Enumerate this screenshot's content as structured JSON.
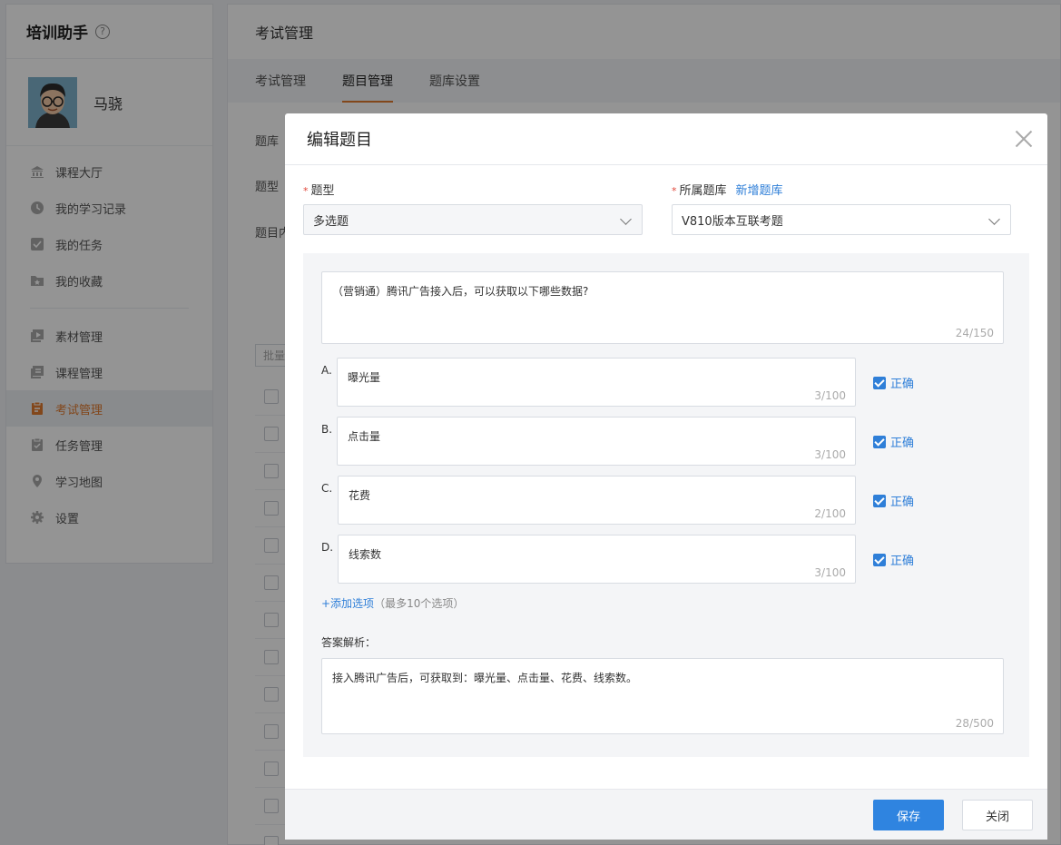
{
  "app": {
    "title": "培训助手",
    "help_icon": "?",
    "user_name": "马骁"
  },
  "sidebar": {
    "items": [
      {
        "label": "课程大厅",
        "icon": "bank-icon"
      },
      {
        "label": "我的学习记录",
        "icon": "clock-icon"
      },
      {
        "label": "我的任务",
        "icon": "checkbox-icon"
      },
      {
        "label": "我的收藏",
        "icon": "star-folder-icon"
      },
      {
        "label": "素材管理",
        "icon": "media-icon"
      },
      {
        "label": "课程管理",
        "icon": "course-icon"
      },
      {
        "label": "考试管理",
        "icon": "exam-icon",
        "active": true
      },
      {
        "label": "任务管理",
        "icon": "task-icon"
      },
      {
        "label": "学习地图",
        "icon": "map-pin-icon"
      },
      {
        "label": "设置",
        "icon": "gear-icon"
      }
    ]
  },
  "main": {
    "header": "考试管理",
    "tabs": [
      {
        "label": "考试管理"
      },
      {
        "label": "题目管理",
        "active": true
      },
      {
        "label": "题库设置"
      }
    ],
    "labels": {
      "bank": "题库",
      "type": "题型",
      "content": "题目内",
      "batch": "批量"
    }
  },
  "modal": {
    "title": "编辑题目",
    "type_label": "题型",
    "type_value": "多选题",
    "bank_label": "所属题库",
    "add_bank_link": "新增题库",
    "bank_value": "V810版本互联考题",
    "question": {
      "text": "（营销通）腾讯广告接入后，可以获取以下哪些数据?",
      "counter": "24/150"
    },
    "options": [
      {
        "letter": "A.",
        "text": "曝光量",
        "counter": "3/100",
        "correct_label": "正确",
        "correct": true
      },
      {
        "letter": "B.",
        "text": "点击量",
        "counter": "3/100",
        "correct_label": "正确",
        "correct": true
      },
      {
        "letter": "C.",
        "text": "花费",
        "counter": "2/100",
        "correct_label": "正确",
        "correct": true
      },
      {
        "letter": "D.",
        "text": "线索数",
        "counter": "3/100",
        "correct_label": "正确",
        "correct": true
      }
    ],
    "add_option": "+添加选项",
    "add_option_hint": "（最多10个选项）",
    "answer_label": "答案解析：",
    "answer": {
      "text": "接入腾讯广告后，可获取到：曝光量、点击量、花费、线索数。",
      "counter": "28/500"
    },
    "save_label": "保存",
    "close_label": "关闭"
  },
  "colors": {
    "accent_orange": "#e07a2f",
    "primary_blue": "#2f84e0",
    "link_blue": "#2f7fd8",
    "required_red": "#e0463a"
  }
}
